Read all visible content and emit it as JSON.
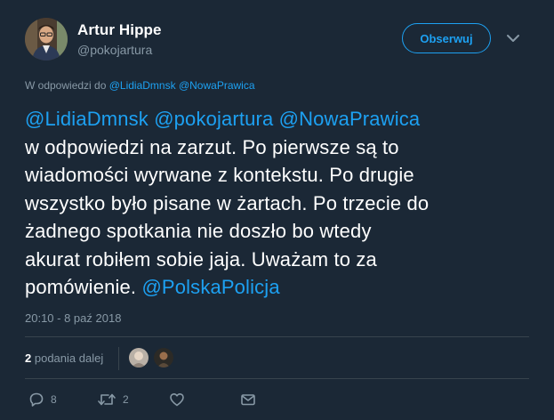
{
  "author": {
    "name": "Artur Hippe",
    "handle": "@pokojartura"
  },
  "follow_label": "Obserwuj",
  "reply_to": {
    "prefix": "W odpowiedzi do",
    "handles": [
      "@LidiaDmnsk",
      "@NowaPrawica"
    ]
  },
  "tweet": {
    "line1_mentions": [
      "@LidiaDmnsk",
      "@pokojartura",
      "@NowaPrawica"
    ],
    "line2": "w odpowiedzi na zarzut. Po pierwsze są to",
    "line3": "wiadomości wyrwane z kontekstu. Po drugie",
    "line4": "wszystko było pisane w żartach. Po trzecie do",
    "line5": "żadnego spotkania nie doszło bo wtedy",
    "line6": "akurat robiłem sobie jaja. Uważam to za",
    "line7_text": "pomówienie.",
    "line7_mention": "@PolskaPolicja"
  },
  "timestamp": "20:10 - 8 paź 2018",
  "retweets": {
    "count": "2",
    "label": "podania dalej"
  },
  "actions": {
    "replies": "8",
    "retweets": "2"
  },
  "colors": {
    "background": "#1b2836",
    "accent": "#1da1f2",
    "muted": "#8899a6",
    "divider": "#38444d"
  },
  "icons": {
    "reply": "reply-icon",
    "retweet": "retweet-icon",
    "like": "heart-icon",
    "dm": "envelope-icon",
    "menu": "chevron-down-icon"
  }
}
